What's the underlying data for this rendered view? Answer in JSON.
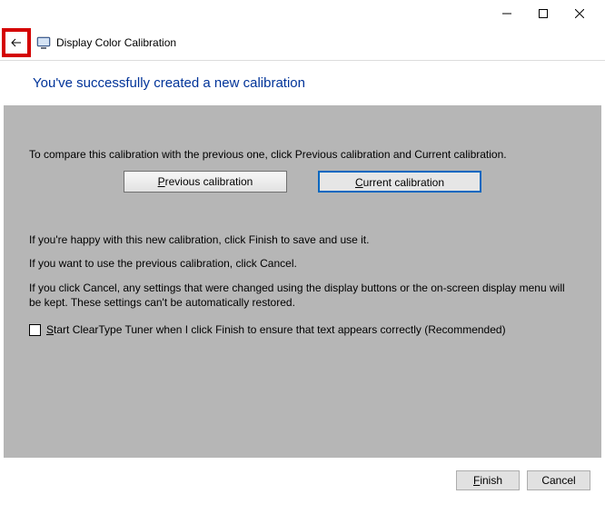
{
  "window": {
    "app_title": "Display Color Calibration"
  },
  "heading": "You've successfully created a new calibration",
  "content": {
    "intro": "To compare this calibration with the previous one, click Previous calibration and Current calibration.",
    "prev_btn": "Previous calibration",
    "curr_btn": "Current calibration",
    "happy": "If you're happy with this new calibration, click Finish to save and use it.",
    "previous": "If you want to use the previous calibration, click Cancel.",
    "cancel_note": "If you click Cancel, any settings that were changed using the display buttons or the on-screen display menu will be kept. These settings can't be automatically restored.",
    "cleartype": "Start ClearType Tuner when I click Finish to ensure that text appears correctly (Recommended)"
  },
  "footer": {
    "finish": "Finish",
    "cancel": "Cancel"
  }
}
